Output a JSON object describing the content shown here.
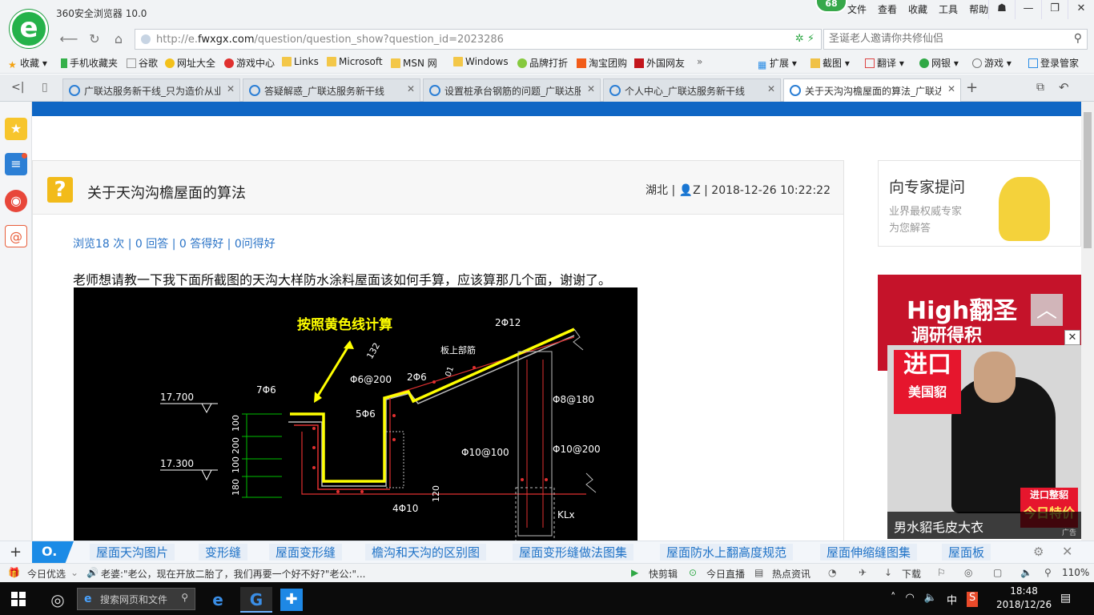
{
  "app": {
    "title": "360安全浏览器 10.0",
    "badge": "68",
    "menu": [
      "文件",
      "查看",
      "收藏",
      "工具",
      "帮助"
    ]
  },
  "address": {
    "url_prefix": "http://e.",
    "url_domain": "fwxgx.com",
    "url_path": "/question/question_show?question_id=2023286",
    "search_placeholder": "圣诞老人邀请你共修仙侣"
  },
  "bookmarks": [
    "收藏",
    "手机收藏夹",
    "谷歌",
    "网址大全",
    "游戏中心",
    "Links",
    "Microsoft",
    "MSN 网",
    "Windows",
    "品牌打折",
    "淘宝团购",
    "外国网友",
    "扩展",
    "截图",
    "翻译",
    "网银",
    "游戏",
    "登录管家"
  ],
  "tabs": [
    {
      "label": "广联达服务新干线_只为造价从业"
    },
    {
      "label": "答疑解惑_广联达服务新干线"
    },
    {
      "label": "设置桩承台钢筋的问题_广联达服"
    },
    {
      "label": "个人中心_广联达服务新干线"
    },
    {
      "label": "关于天沟沟檐屋面的算法_广联达"
    }
  ],
  "question": {
    "icon": "?",
    "title": "关于天沟沟檐屋面的算法",
    "meta": "湖北 | 👤Z | 2018-12-26 10:22:22",
    "stats": "浏览18 次 | 0 回答 | 0 答得好 | 0问得好",
    "body": "老师想请教一下我下面所截图的天沟大样防水涂料屋面该如何手算，应该算那几个面，谢谢了。"
  },
  "cad": {
    "note": "按照黄色线计算",
    "labels": [
      "17.700",
      "17.300",
      "7Φ6",
      "5Φ6",
      "Φ6@200",
      "2Φ6",
      "板上部筋",
      "2Φ12",
      "Φ8@180",
      "Φ10@100",
      "Φ10@200",
      "4Φ10",
      "KLx",
      "100",
      "200",
      "100",
      "180",
      "120",
      "132",
      "01"
    ]
  },
  "sidebar_right": {
    "expert_title": "向专家提问",
    "expert_sub1": "业界最权威专家",
    "expert_sub2": "为您解答",
    "ad_red_text1": "High翻圣",
    "ad_red_text2": "调研得积",
    "float_ad_tag1_line1": "进口",
    "float_ad_tag1_line2": "美国貂",
    "float_ad_tag2_line1": "进口整貂",
    "float_ad_tag2_line2": "今日特价",
    "float_ad_caption": "男水貂毛皮大衣",
    "float_ad_label": "广告"
  },
  "related": [
    "屋面天沟图片",
    "变形缝",
    "屋面变形缝",
    "檐沟和天沟的区别图",
    "屋面变形缝做法图集",
    "屋面防水上翻高度规范",
    "屋面伸缩缝图集",
    "屋面板"
  ],
  "status": {
    "today_pick": "今日优选",
    "news": "老婆:\"老公，现在开放二胎了，我们再要一个好不好?\"老公:\"...",
    "quick_edit": "快剪辑",
    "live": "今日直播",
    "hot": "热点资讯",
    "download": "下载",
    "zoom": "110%"
  },
  "taskbar": {
    "search_placeholder": "搜索网页和文件",
    "ime": "中",
    "time": "18:48",
    "date": "2018/12/26"
  },
  "colors": {
    "brand_green": "#25b24a",
    "page_blue": "#0f66c4",
    "link_blue": "#2b74c7",
    "cad_yellow": "#ffff00"
  }
}
